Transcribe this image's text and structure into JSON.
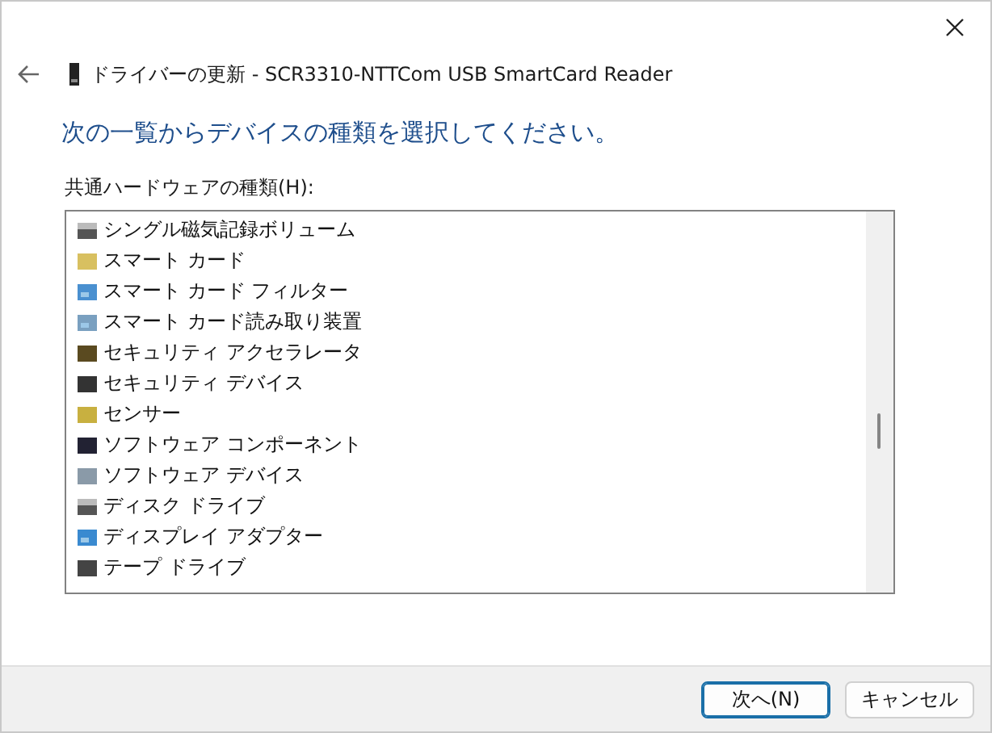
{
  "window": {
    "title": "ドライバーの更新 - SCR3310-NTTCom USB SmartCard Reader"
  },
  "heading": "次の一覧からデバイスの種類を選択してください。",
  "list_label": "共通ハードウェアの種類(H):",
  "items": [
    {
      "label": "シングル磁気記録ボリューム",
      "selected": false
    },
    {
      "label": "スマート カード",
      "selected": false
    },
    {
      "label": "スマート カード フィルター",
      "selected": false
    },
    {
      "label": "スマート カード読み取り装置",
      "selected": false
    },
    {
      "label": "セキュリティ アクセラレータ",
      "selected": false
    },
    {
      "label": "セキュリティ デバイス",
      "selected": false
    },
    {
      "label": "センサー",
      "selected": false
    },
    {
      "label": "ソフトウェア コンポーネント",
      "selected": false
    },
    {
      "label": "ソフトウェア デバイス",
      "selected": false
    },
    {
      "label": "ディスク ドライブ",
      "selected": false
    },
    {
      "label": "ディスプレイ アダプター",
      "selected": false
    },
    {
      "label": "テープ ドライブ",
      "selected": false
    }
  ],
  "buttons": [
    {
      "label": "次へ(N)",
      "kind": "primary"
    },
    {
      "label": "キャンセル",
      "kind": "secondary"
    }
  ]
}
